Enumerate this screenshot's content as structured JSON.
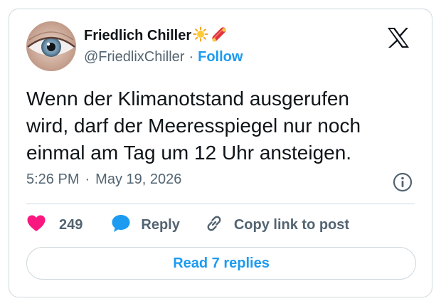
{
  "author": {
    "display_name": "Friedlich Chiller",
    "name_emojis": [
      "sun-icon",
      "skateboard-icon"
    ],
    "handle": "@FriedlixChiller",
    "separator": "·",
    "follow_label": "Follow"
  },
  "tweet": {
    "text_lines": [
      "Wenn der Klimanotstand ausgerufen",
      "wird, darf der Meeresspiegel nur noch",
      "einmal am Tag um 12 Uhr ansteigen."
    ],
    "time": "5:26 PM",
    "separator": "·",
    "date": "May 19, 2026"
  },
  "actions": {
    "like_count": "249",
    "reply_label": "Reply",
    "copy_label": "Copy link to post"
  },
  "footer": {
    "read_replies_label": "Read 7 replies"
  },
  "colors": {
    "accent": "#1d9bf0",
    "like": "#f91880",
    "secondary_text": "#536471",
    "border": "#cfd9de"
  }
}
